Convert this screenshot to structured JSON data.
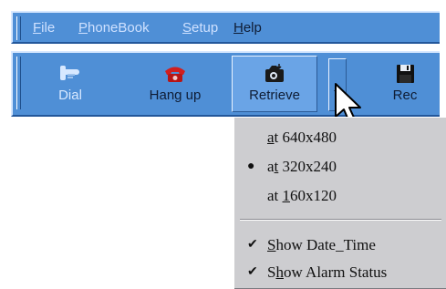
{
  "menubar": {
    "items": [
      {
        "label": "File",
        "accel": "F",
        "rest": "ile",
        "dim": true
      },
      {
        "label": "PhoneBook",
        "accel": "P",
        "rest": "honeBook",
        "dim": true
      },
      {
        "label": "Setup",
        "accel": "S",
        "rest": "etup",
        "dim": true
      },
      {
        "label": "Help",
        "accel": "H",
        "rest": "elp",
        "dim": false
      }
    ]
  },
  "toolbar": {
    "buttons": [
      {
        "label": "Dial",
        "icon": "phone-pointer-icon",
        "disabled": true
      },
      {
        "label": "Hang up",
        "icon": "red-telephone-icon",
        "disabled": false
      },
      {
        "label": "Retrieve",
        "icon": "retrieve-camera-icon",
        "disabled": false,
        "pressed": true
      },
      {
        "label": "Rec",
        "icon": "floppy-disk-icon",
        "disabled": false
      }
    ]
  },
  "retrieve_menu": {
    "items": [
      {
        "pre": "",
        "accel": "a",
        "post": "t 640x480",
        "checked": false,
        "mark": ""
      },
      {
        "pre": "a",
        "accel": "t",
        "post": " 320x240",
        "checked": true,
        "mark": "●"
      },
      {
        "pre": "at ",
        "accel": "1",
        "post": "60x120",
        "checked": false,
        "mark": ""
      },
      {
        "pre": "",
        "accel": "S",
        "post": "how Date_Time",
        "checked": true,
        "mark": "✔"
      },
      {
        "pre": "S",
        "accel": "h",
        "post": "ow Alarm Status",
        "checked": true,
        "mark": "✔"
      }
    ]
  }
}
